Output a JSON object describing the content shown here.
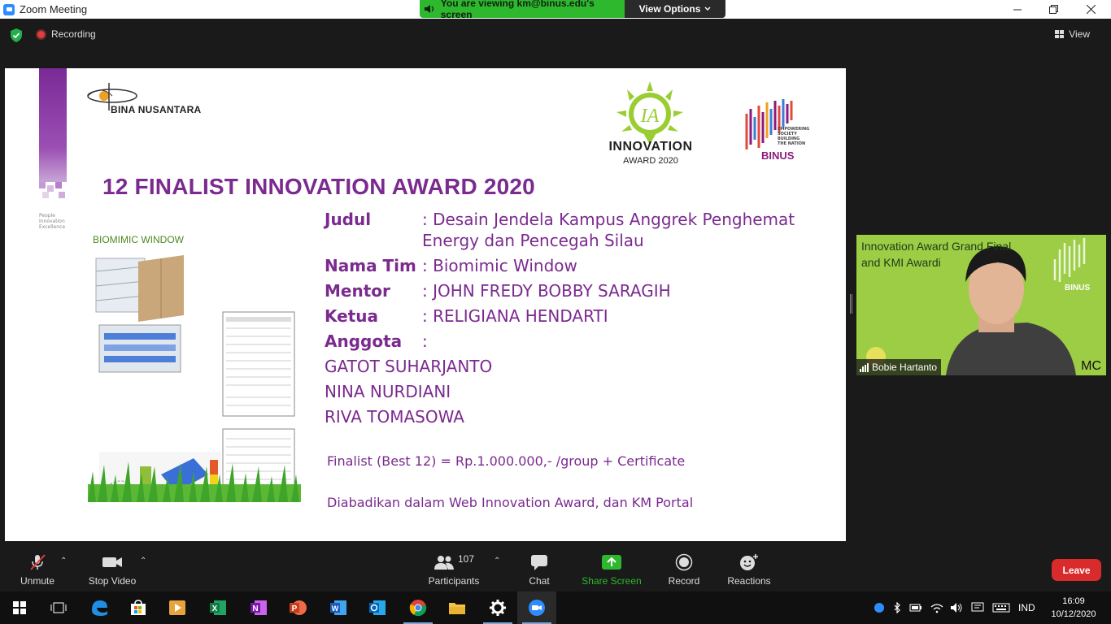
{
  "window": {
    "title": "Zoom Meeting",
    "controls": [
      "minimize",
      "maximize",
      "close"
    ]
  },
  "banner": {
    "viewing_text": "You are viewing km@binus.edu's screen",
    "view_options_label": "View Options"
  },
  "topbar": {
    "recording_label": "Recording",
    "view_label": "View"
  },
  "slide": {
    "brand_left": "BINA NUSANTARA",
    "brand_tagline": [
      "People",
      "Innovation",
      "Excellence"
    ],
    "award_logo_text": "INNOVATION",
    "award_logo_year": "AWARD 2020",
    "binus_tagline": [
      "EMPOWERING",
      "SOCIETY",
      "BUILDING",
      "THE NATION"
    ],
    "binus_word": "BINUS",
    "title": "12 FINALIST INNOVATION AWARD 2020",
    "illustration_title": "BIOMIMIC WINDOW",
    "rows": [
      {
        "label": "Judul",
        "value_line1": ": Desain Jendela Kampus Anggrek Penghemat",
        "value_line2": "Energy dan Pencegah Silau"
      },
      {
        "label": "Nama Tim",
        "value_line1": ": Biomimic Window"
      },
      {
        "label": "Mentor",
        "value_line1": ": JOHN FREDY BOBBY SARAGIH"
      },
      {
        "label": "Ketua",
        "value_line1": ": RELIGIANA HENDARTI"
      },
      {
        "label": "Anggota",
        "value_line1": ":"
      }
    ],
    "members": [
      "GATOT SUHARJANTO",
      "NINA NURDIANI",
      "RIVA TOMASOWA"
    ],
    "prize": "Finalist (Best 12) = Rp.1.000.000,- /group + Certificate",
    "note": "Diabadikan dalam Web Innovation Award, dan KM Portal"
  },
  "video": {
    "overlay_line1": "Innovation Award Grand Final",
    "overlay_line2": "and KMI Awardi",
    "participant_name": "Bobie Hartanto",
    "corner_text": "MC"
  },
  "toolbar": {
    "unmute": "Unmute",
    "stop_video": "Stop Video",
    "participants": "Participants",
    "participants_count": "107",
    "chat": "Chat",
    "share_screen": "Share Screen",
    "record": "Record",
    "reactions": "Reactions",
    "leave": "Leave"
  },
  "taskbar": {
    "language": "IND",
    "time": "16:09",
    "date": "10/12/2020"
  },
  "colors": {
    "accent_purple": "#7b2a8f",
    "share_green": "#2eb82e",
    "leave_red": "#d92b2b"
  }
}
